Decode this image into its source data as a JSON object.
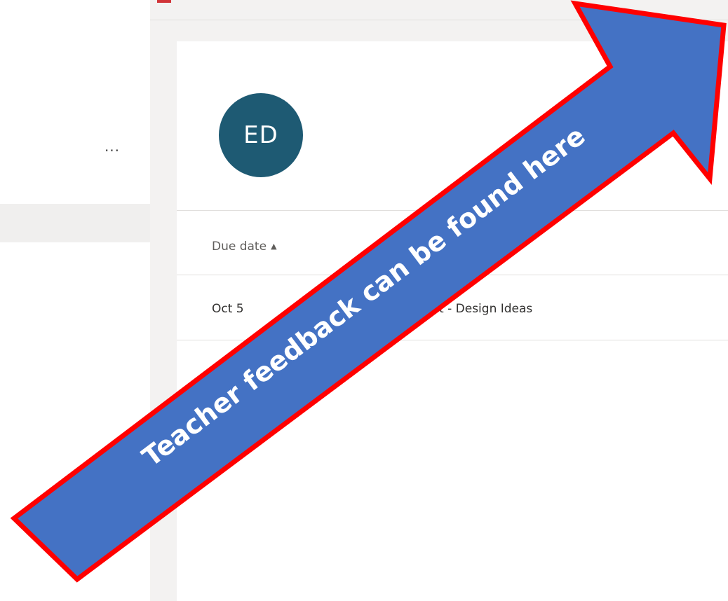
{
  "left_pane": {
    "more_label": "···"
  },
  "card": {
    "avatar_initials": "ED",
    "table": {
      "headers": {
        "due_date": "Due date",
        "sort_indicator": "▲"
      },
      "rows": [
        {
          "due_date": "Oct 5",
          "title": "werpoint - Design Ideas"
        }
      ]
    }
  },
  "callout": {
    "text": "Teacher feedback can be found here",
    "fill_color": "#4472c4",
    "border_color": "#ff0000",
    "text_color": "#ffffff"
  },
  "colors": {
    "avatar": "#1e5a73",
    "background": "#f3f2f1",
    "accent_red": "#d13438"
  }
}
